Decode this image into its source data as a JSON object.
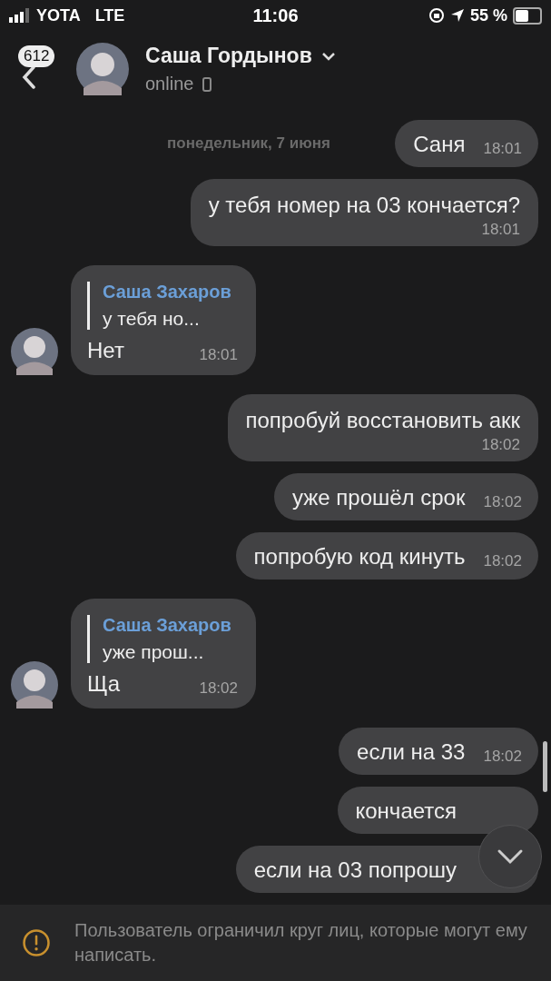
{
  "status_bar": {
    "carrier": "YOTA",
    "network": "LTE",
    "time": "11:06",
    "battery": "55 %"
  },
  "header": {
    "unread_count": "612",
    "name": "Саша Гордынов",
    "status": "online"
  },
  "date_label": "понедельник, 7 июня",
  "messages": [
    {
      "kind": "out",
      "text": "Саня",
      "time": "18:01"
    },
    {
      "kind": "out",
      "text": "у тебя номер на 03 кончается?",
      "time": "18:01",
      "wrap": true
    },
    {
      "kind": "in",
      "reply": {
        "author": "Саша Захаров",
        "text": "у тебя но..."
      },
      "text": "Нет",
      "time": "18:01"
    },
    {
      "kind": "out",
      "text": "попробуй восстановить акк",
      "time": "18:02",
      "wrap": true
    },
    {
      "kind": "out",
      "text": "уже прошёл срок",
      "time": "18:02"
    },
    {
      "kind": "out",
      "text": "попробую код кинуть",
      "time": "18:02"
    },
    {
      "kind": "in",
      "reply": {
        "author": "Саша Захаров",
        "text": "уже прош..."
      },
      "text": "Ща",
      "time": "18:02"
    },
    {
      "kind": "out",
      "text": "если на 33",
      "time": "18:02"
    },
    {
      "kind": "out",
      "text": "кончается"
    },
    {
      "kind": "out",
      "text": "если на 03 попрошу"
    }
  ],
  "notice": "Пользователь ограничил круг лиц, которые могут ему написать."
}
